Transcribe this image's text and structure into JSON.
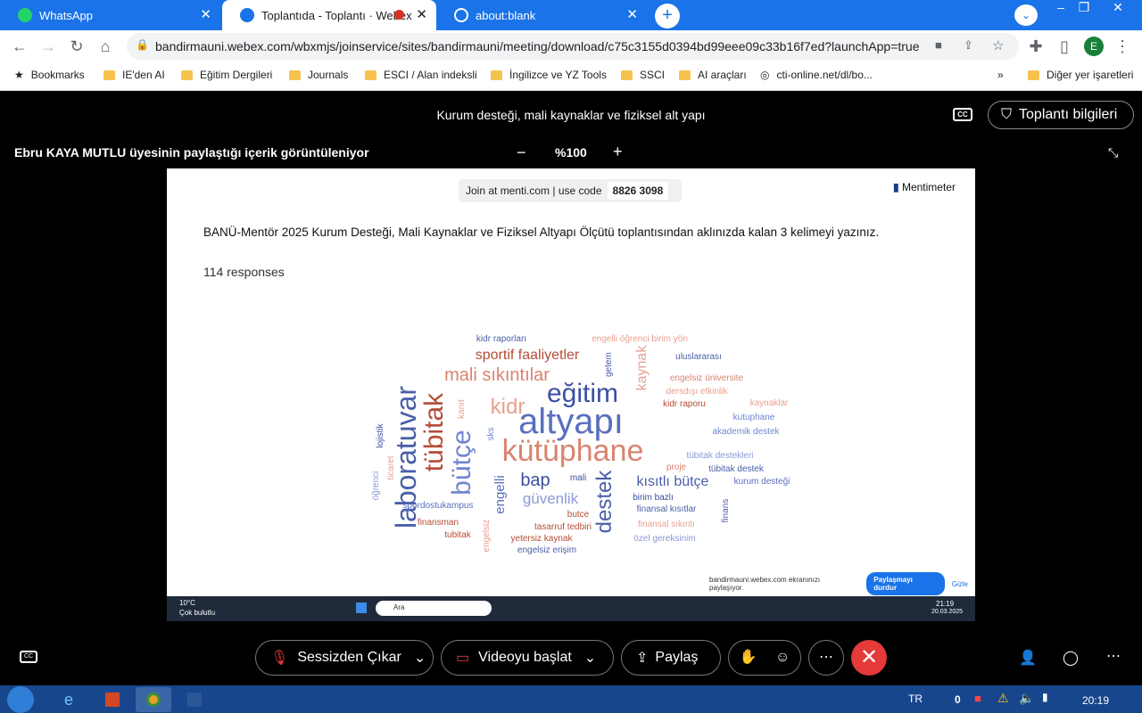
{
  "browser": {
    "tabs": [
      {
        "title": "WhatsApp",
        "icon": "whatsapp-icon"
      },
      {
        "title": "Toplantıda - Toplantı · Webex",
        "icon": "webex-icon",
        "active": true
      },
      {
        "title": "about:blank",
        "icon": "globe-icon"
      }
    ],
    "url": "bandirmauni.webex.com/wbxmjs/joinservice/sites/bandirmauni/meeting/download/c75c3155d0394bd99eee09c33b16f7ed?launchApp=true",
    "profile_initial": "E",
    "bookmarks": [
      "Bookmarks",
      "IE'den AI",
      "Eğitim Dergileri",
      "Journals",
      "ESCI / Alan indeksli",
      "İngilizce ve YZ Tools",
      "SSCI",
      "AI araçları",
      "cti-online.net/dl/bo...",
      "Diğer yer işaretleri"
    ],
    "accent": "#1a73e8"
  },
  "meeting": {
    "title": "Kurum desteği, mali kaynaklar ve fiziksel alt yapı",
    "info_button": "Toplantı bilgileri",
    "cc_label": "CC",
    "sharing_label": "Ebru KAYA MUTLU üyesinin paylaştığı içerik görüntüleniyor",
    "zoom": "%100",
    "zoom_minus": "−",
    "zoom_plus": "+"
  },
  "slide": {
    "join_text": "Join at menti.com | use code",
    "join_code": "8826 3098",
    "brand": "Mentimeter",
    "question": "BANÜ-Mentör 2025 Kurum Desteği, Mali Kaynaklar ve Fiziksel Altyapı Ölçütü toplantısından aklınızda kalan 3 kelimeyi yazınız.",
    "responses": "114 responses",
    "share_notice": "bandirmauni.webex.com ekranınızı paylaşıyor.",
    "stop_share": "Paylaşmayı durdur",
    "hide": "Gizle",
    "taskbar_search": "Ara",
    "taskbar_weather": "10°C",
    "taskbar_weather2": "Çok bulutlu",
    "taskbar_time": "21:19",
    "taskbar_date": "20.03.2025",
    "word_cloud": [
      {
        "w": "altyapı",
        "c": "#5a6fc0"
      },
      {
        "w": "kütüphane",
        "c": "#d9846f"
      },
      {
        "w": "eğitim",
        "c": "#3b4fa0"
      },
      {
        "w": "tübitak",
        "c": "#b44d36"
      },
      {
        "w": "laboratuvar",
        "c": "#4a5ea8"
      },
      {
        "w": "bütçe",
        "c": "#6f86d0"
      },
      {
        "w": "kidr",
        "c": "#e8a090"
      },
      {
        "w": "mali sıkıntılar",
        "c": "#d9846f"
      },
      {
        "w": "sportif faaliyetler",
        "c": "#b44d36"
      },
      {
        "w": "bap",
        "c": "#3b4fa0"
      },
      {
        "w": "kısıtlı bütçe",
        "c": "#4a5ea8"
      },
      {
        "w": "güvenlik",
        "c": "#8b9ad8"
      },
      {
        "w": "destek",
        "c": "#4a5ea8"
      },
      {
        "w": "engelli",
        "c": "#5a6fc0"
      },
      {
        "w": "kaynak",
        "c": "#e8a090"
      },
      {
        "w": "kidr raporları",
        "c": "#4a5ea8"
      },
      {
        "w": "engelli öğrenci birim yön",
        "c": "#e8a090"
      },
      {
        "w": "uluslararası",
        "c": "#4a5ea8"
      },
      {
        "w": "engelsiz üniversite",
        "c": "#d9846f"
      },
      {
        "w": "dersdışı etkinlik",
        "c": "#e8a090"
      },
      {
        "w": "kidr raporu",
        "c": "#b44d36"
      },
      {
        "w": "kaynaklar",
        "c": "#e8a090"
      },
      {
        "w": "kutuphane",
        "c": "#6f86d0"
      },
      {
        "w": "akademik destek",
        "c": "#6f86d0"
      },
      {
        "w": "tübitak destekleri",
        "c": "#8b9ad8"
      },
      {
        "w": "tübitak destek",
        "c": "#4a5ea8"
      },
      {
        "w": "kurum desteği",
        "c": "#5a6fc0"
      },
      {
        "w": "proje",
        "c": "#d9846f"
      },
      {
        "w": "mali",
        "c": "#3b4fa0"
      },
      {
        "w": "birim bazlı",
        "c": "#3b4fa0"
      },
      {
        "w": "finansal kısıtlar",
        "c": "#4a5ea8"
      },
      {
        "w": "finansal sıkıntı",
        "c": "#e8a090"
      },
      {
        "w": "özel gereksinim",
        "c": "#8b9ad8"
      },
      {
        "w": "finans",
        "c": "#4a5ea8"
      },
      {
        "w": "butce",
        "c": "#b44d36"
      },
      {
        "w": "tasarruf tedbiri",
        "c": "#b44d36"
      },
      {
        "w": "yetersiz kaynak",
        "c": "#b44d36"
      },
      {
        "w": "engelsiz erişim",
        "c": "#4a5ea8"
      },
      {
        "w": "spordostukampus",
        "c": "#5a6fc0"
      },
      {
        "w": "finansman",
        "c": "#b44d36"
      },
      {
        "w": "tubitak",
        "c": "#b44d36"
      },
      {
        "w": "engelsiz",
        "c": "#e8a090"
      },
      {
        "w": "lojistik",
        "c": "#3b4fa0"
      },
      {
        "w": "ticaret",
        "c": "#e8a090"
      },
      {
        "w": "öğrenci",
        "c": "#8b9ad8"
      },
      {
        "w": "getem",
        "c": "#4a5ea8"
      },
      {
        "w": "kanıt",
        "c": "#e8a090"
      },
      {
        "w": "sks",
        "c": "#6f86d0"
      }
    ]
  },
  "controls": {
    "mute": "Sessizden Çıkar",
    "video": "Videoyu başlat",
    "share": "Paylaş",
    "end_color": "#e43a3a"
  },
  "os": {
    "lang": "TR",
    "time": "20:19",
    "tray_count": "0"
  }
}
